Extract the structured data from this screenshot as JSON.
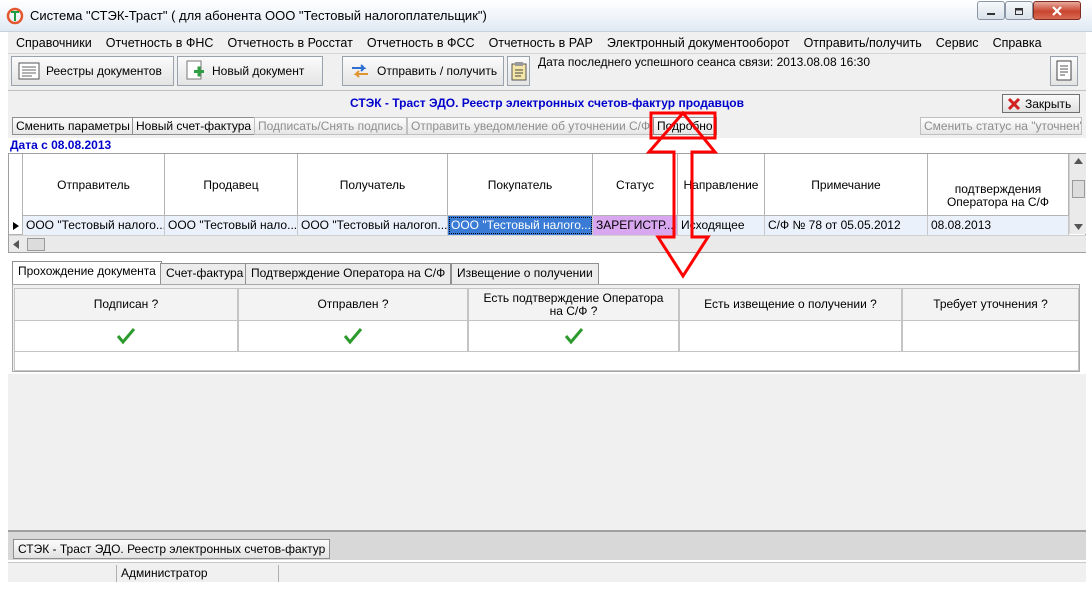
{
  "window": {
    "title": "Система \"СТЭК-Траст\" ( для абонента ООО \"Тестовый налогоплательщик\")"
  },
  "menu": [
    "Справочники",
    "Отчетность в ФНС",
    "Отчетность в Росстат",
    "Отчетность в ФСС",
    "Отчетность в РАР",
    "Электронный документооборот",
    "Отправить/получить",
    "Сервис",
    "Справка"
  ],
  "toolbar": {
    "registries_label": "Реестры документов",
    "new_doc_label": "Новый документ",
    "send_receive_label": "Отправить / получить",
    "last_session_text": "Дата последнего успешного сеанса связи: 2013.08.08 16:30"
  },
  "registry": {
    "title": "СТЭК - Траст ЭДО. Реестр электронных счетов-фактур продавцов",
    "close_label": "Закрыть",
    "date_label": "Дата с 08.08.2013"
  },
  "actions": {
    "change_params": "Сменить параметры",
    "new_invoice": "Новый счет-фактура",
    "sign_unsign": "Подписать/Снять подпись",
    "send_notice": "Отправить уведомление об уточнении С/Ф",
    "details": "Подробно",
    "change_status": "Сменить статус на \"уточнен\""
  },
  "grid": {
    "columns": [
      "Отправитель",
      "Продавец",
      "Получатель",
      "Покупатель",
      "Статус",
      "Направление",
      "Примечание",
      "подтверждения Оператора на С/Ф"
    ],
    "rows": [
      [
        "ООО \"Тестовый налого...",
        "ООО \"Тестовый нало...",
        "ООО \"Тестовый налогоп...",
        "ООО \"Тестовый налого...",
        "ЗАРЕГИСТР...",
        "Исходящее",
        "С/Ф № 78 от 05.05.2012",
        "08.08.2013"
      ]
    ],
    "status_color": "#d9a6f0",
    "selected_cell_color": "#3a7bd5"
  },
  "tabs": [
    "Прохождение документа",
    "Счет-фактура",
    "Подтверждение Оператора на С/Ф",
    "Извещение о получении"
  ],
  "detail": {
    "columns": [
      "Подписан ?",
      "Отправлен ?",
      "Есть подтверждение Оператора на С/Ф ?",
      "Есть извещение о получении ?",
      "Требует уточнения ?"
    ],
    "values": [
      true,
      true,
      true,
      false,
      false
    ]
  },
  "bottom": {
    "window_tab_label": "СТЭК - Траст ЭДО. Реестр электронных счетов-фактур",
    "status_user": "Администратор"
  },
  "colors": {
    "accent_blue": "#0000cc",
    "annotation_red": "#ff0000",
    "check_green": "#2d9a2d"
  }
}
